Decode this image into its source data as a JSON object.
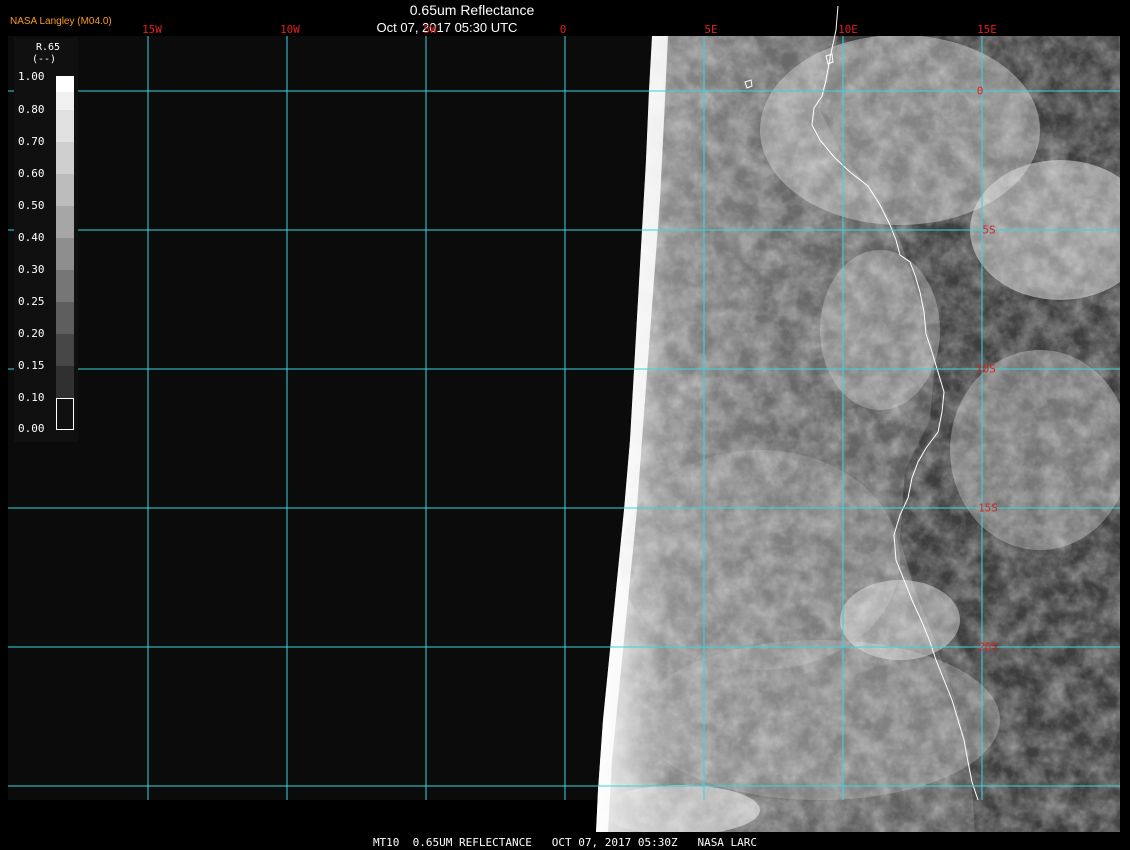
{
  "header": {
    "title": "0.65um Reflectance",
    "date": "Oct 07, 2017 05:30 UTC",
    "producer": "NASA Langley (M04.0)"
  },
  "legend": {
    "name": "R.65",
    "units": "(--)",
    "ticks": [
      "1.00",
      "0.80",
      "0.70",
      "0.60",
      "0.50",
      "0.40",
      "0.30",
      "0.25",
      "0.20",
      "0.15",
      "0.10",
      "0.00"
    ]
  },
  "grid": {
    "lon_labels": [
      "15W",
      "10W",
      "5W",
      "0",
      "5E",
      "10E",
      "15E"
    ],
    "lat_labels": [
      "0",
      "5S",
      "10S",
      "15S",
      "20S"
    ],
    "grid_color": "#39d4e0",
    "label_color": "#e0201a"
  },
  "footer": {
    "text": "MT10  0.65UM REFLECTANCE   OCT 07, 2017 05:30Z   NASA LARC"
  },
  "colors": {
    "producer": "#ff9a1f",
    "coastline": "#ffffff"
  }
}
